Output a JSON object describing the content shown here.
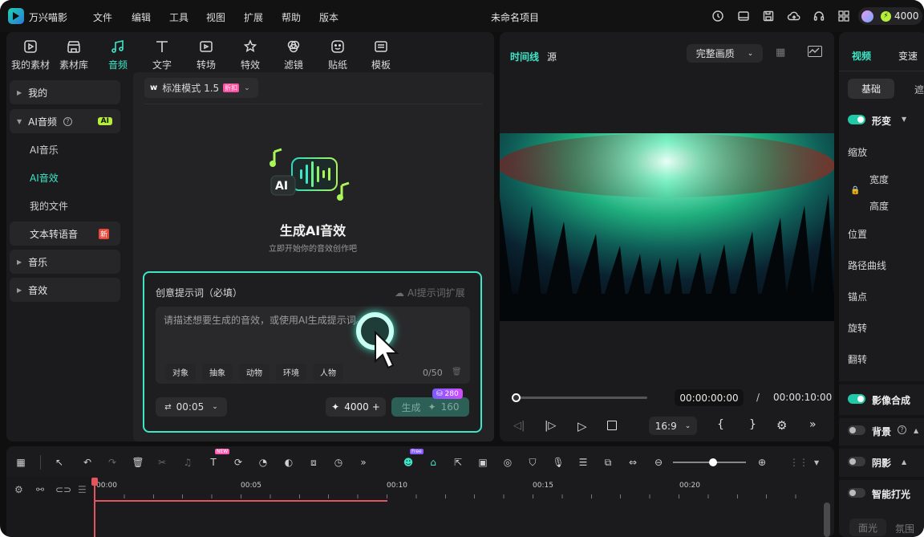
{
  "app": {
    "name": "万兴喵影",
    "project_title": "未命名项目",
    "credits": "4000"
  },
  "menu": [
    "文件",
    "编辑",
    "工具",
    "视图",
    "扩展",
    "帮助",
    "版本"
  ],
  "tools": [
    {
      "label": "我的素材",
      "icon": "media-icon"
    },
    {
      "label": "素材库",
      "icon": "store-icon"
    },
    {
      "label": "音频",
      "icon": "music-icon"
    },
    {
      "label": "文字",
      "icon": "text-icon"
    },
    {
      "label": "转场",
      "icon": "transition-icon"
    },
    {
      "label": "特效",
      "icon": "effects-icon"
    },
    {
      "label": "滤镜",
      "icon": "filter-icon"
    },
    {
      "label": "贴纸",
      "icon": "sticker-icon"
    },
    {
      "label": "模板",
      "icon": "template-icon"
    }
  ],
  "sidebar": {
    "mine": "我的",
    "ai_audio": "AI音频",
    "ai_badge": "AI",
    "ai_music": "AI音乐",
    "ai_sfx": "AI音效",
    "my_files": "我的文件",
    "tts": "文本转语音",
    "tts_badge": "新",
    "music": "音乐",
    "sfx": "音效"
  },
  "center": {
    "mode": "标准模式 1.5",
    "mode_badge": "折扣",
    "hero_badge": "AI",
    "hero_title": "生成AI音效",
    "hero_sub": "立即开始你的音效创作吧",
    "prompt_label": "创意提示词（必填）",
    "prompt_ext": "AI提示词扩展",
    "prompt_placeholder": "请描述想要生成的音效，或使用AI生成提示词。",
    "tags": [
      "对象",
      "抽象",
      "动物",
      "环境",
      "人物"
    ],
    "counter": "0/50",
    "duration": "00:05",
    "credits_btn": "4000",
    "generate": "生成",
    "generate_cost": "160",
    "cost_badge": "280"
  },
  "preview": {
    "tab_timeline": "时间线",
    "tab_source": "源",
    "quality": "完整画质",
    "current_time": "00:00:00:00",
    "sep": "/",
    "total_time": "00:00:10:00",
    "ratio": "16:9",
    "progress": 0
  },
  "inspector": {
    "tab_video": "视频",
    "tab_speed": "变速",
    "sub_basic": "基础",
    "sub_mask": "遮",
    "transform": "形变",
    "scale": "缩放",
    "width": "宽度",
    "height": "高度",
    "position": "位置",
    "path_curve": "路径曲线",
    "anchor": "锚点",
    "rotate": "旋转",
    "flip": "翻转",
    "compositing": "影像合成",
    "background": "背景",
    "shadow": "阴影",
    "smart_light": "智能打光",
    "bottom_left": "面光",
    "bottom_right": "氛围"
  },
  "timeline": {
    "ticks": [
      "00:00",
      "00:05",
      "00:10",
      "00:15",
      "00:20"
    ],
    "badge_new": "NEW",
    "badge_free": "Free"
  }
}
